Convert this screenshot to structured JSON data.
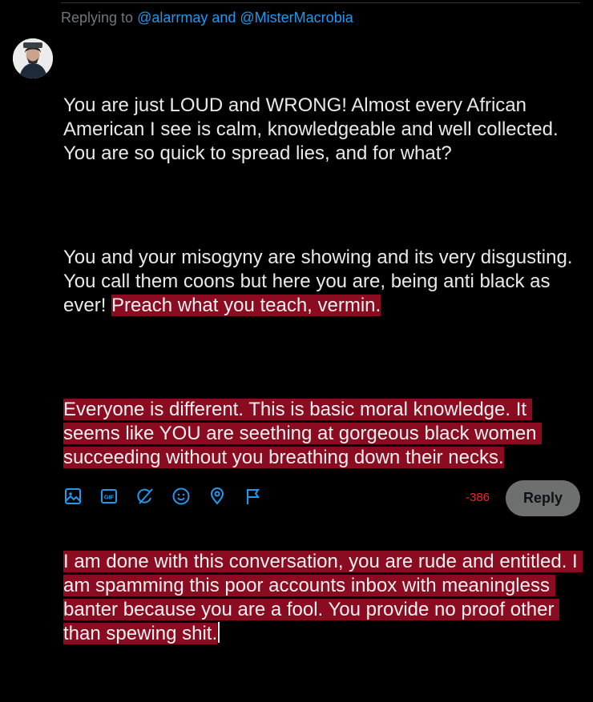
{
  "reply_context": {
    "prefix": "Replying to ",
    "mention1": "@alarrmay",
    "joiner": " and ",
    "mention2": "@MisterMacrobia"
  },
  "composer": {
    "p1": "You are just LOUD and WRONG! Almost every African American I see is calm, knowledgeable and well collected. You are so quick to spread lies, and for what?",
    "p2_normal": "You and your misogyny are showing and its very disgusting. You call them coons but here you are, being anti black as ever! ",
    "p2_over": "Preach what you teach, vermin.",
    "p3_over": "Everyone is different. This is basic moral knowledge. It seems like YOU are seething at gorgeous black women succeeding without you breathing down their necks.",
    "p4_over": "I am done with this conversation, you are rude and entitled. I am spamming this poor accounts inbox with meaningless banter because you are a fool. You provide no proof other than spewing shit."
  },
  "toolbar": {
    "icons": [
      "media-icon",
      "gif-icon",
      "grok-icon",
      "emoji-icon",
      "location-icon",
      "flag-icon"
    ],
    "gif_label": "GIF",
    "char_count": "-386",
    "reply_label": "Reply"
  },
  "colors": {
    "accent": "#1d9bf0",
    "over_limit_bg": "#8b0b21",
    "counter": "#f4212e",
    "button": "#787a7a"
  }
}
